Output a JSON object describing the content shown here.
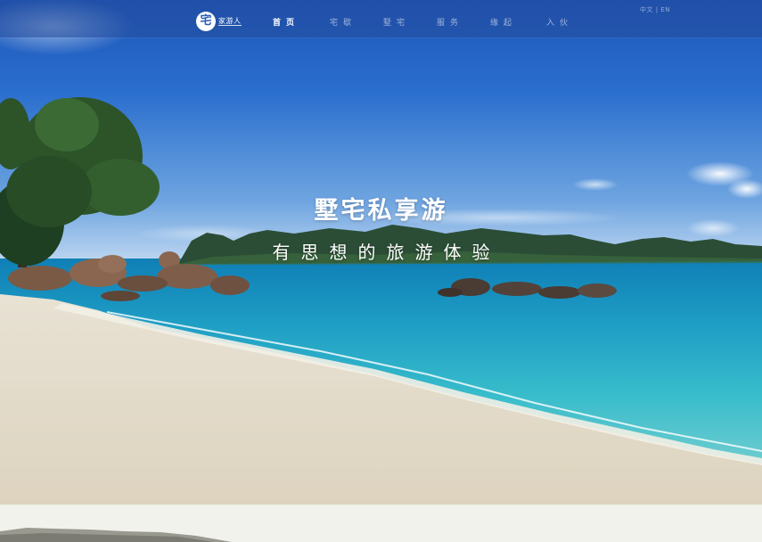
{
  "navbar": {
    "logo": {
      "glyph": "宅",
      "wordmark": "家游人"
    },
    "items": [
      {
        "label": "首页",
        "active": true
      },
      {
        "label": "宅歇",
        "active": false
      },
      {
        "label": "墅宅",
        "active": false
      },
      {
        "label": "服务",
        "active": false
      },
      {
        "label": "缘起",
        "active": false
      },
      {
        "label": "入伙",
        "active": false
      }
    ],
    "language": "中文 | EN"
  },
  "hero": {
    "title": "墅宅私享游",
    "subtitle": "有思想的旅游体验"
  },
  "colors": {
    "nav_background": "#254d9d",
    "sky": "#2a6ccc",
    "sea": "#3fc1cf",
    "sand": "#e8e0d0"
  }
}
